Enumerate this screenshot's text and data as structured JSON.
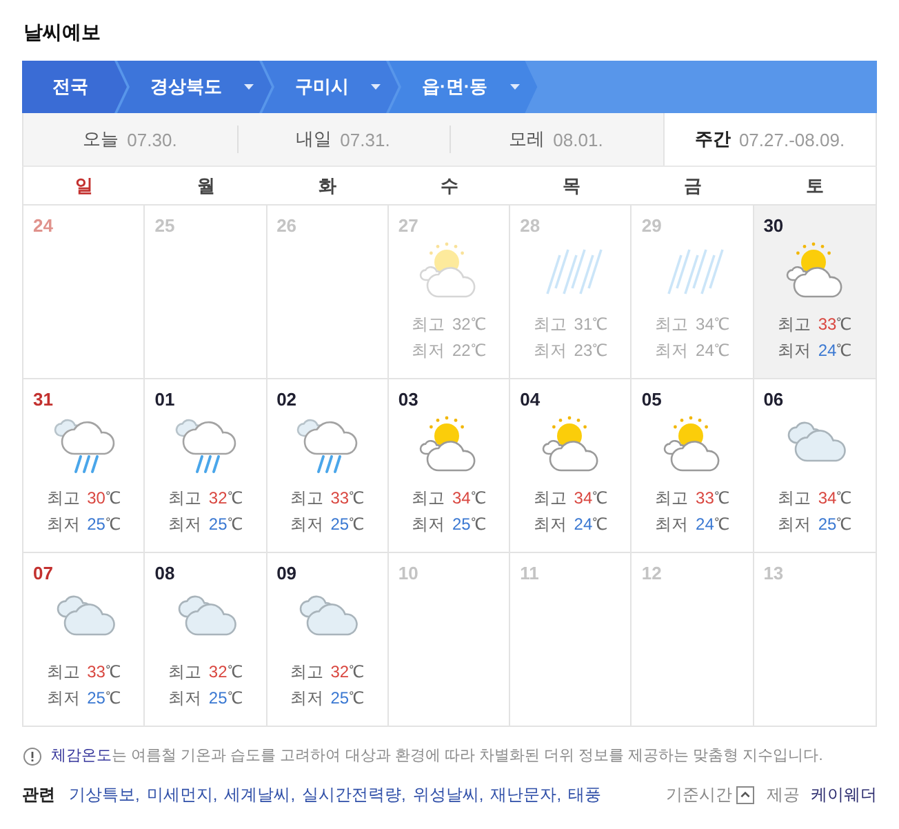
{
  "title": "날씨예보",
  "regions": [
    {
      "label": "전국",
      "dropdown": false
    },
    {
      "label": "경상북도",
      "dropdown": true
    },
    {
      "label": "구미시",
      "dropdown": true
    },
    {
      "label": "읍·면·동",
      "dropdown": true
    }
  ],
  "date_tabs": [
    {
      "label": "오늘",
      "date": "07.30.",
      "selected": false
    },
    {
      "label": "내일",
      "date": "07.31.",
      "selected": false
    },
    {
      "label": "모레",
      "date": "08.01.",
      "selected": false
    },
    {
      "label": "주간",
      "date": "07.27.-08.09.",
      "selected": true
    }
  ],
  "weekdays": [
    {
      "label": "일",
      "holiday": true
    },
    {
      "label": "월",
      "holiday": false
    },
    {
      "label": "화",
      "holiday": false
    },
    {
      "label": "수",
      "holiday": false
    },
    {
      "label": "목",
      "holiday": false
    },
    {
      "label": "금",
      "holiday": false
    },
    {
      "label": "토",
      "holiday": false
    }
  ],
  "weeks": [
    {
      "days": [
        {
          "kind": "empty",
          "date": "24",
          "dimmed": true,
          "today": false
        },
        {
          "kind": "empty",
          "date": "25",
          "dimmed": true,
          "today": false
        },
        {
          "kind": "empty",
          "date": "26",
          "dimmed": true,
          "today": false
        },
        {
          "kind": "suncloud",
          "date": "27",
          "dimmed": true,
          "today": false,
          "temps": [
            {
              "kind": "high",
              "label": "최고",
              "value": "32",
              "unit": "℃"
            },
            {
              "kind": "low",
              "label": "최저",
              "value": "22",
              "unit": "℃"
            }
          ]
        },
        {
          "kind": "rain",
          "date": "28",
          "dimmed": true,
          "today": false,
          "temps": [
            {
              "kind": "high",
              "label": "최고",
              "value": "31",
              "unit": "℃"
            },
            {
              "kind": "low",
              "label": "최저",
              "value": "23",
              "unit": "℃"
            }
          ]
        },
        {
          "kind": "rain",
          "date": "29",
          "dimmed": true,
          "today": false,
          "temps": [
            {
              "kind": "high",
              "label": "최고",
              "value": "34",
              "unit": "℃"
            },
            {
              "kind": "low",
              "label": "최저",
              "value": "24",
              "unit": "℃"
            }
          ]
        },
        {
          "kind": "suncloud",
          "date": "30",
          "dimmed": false,
          "today": true,
          "temps": [
            {
              "kind": "high",
              "label": "최고",
              "value": "33",
              "unit": "℃"
            },
            {
              "kind": "low",
              "label": "최저",
              "value": "24",
              "unit": "℃"
            }
          ]
        }
      ]
    },
    {
      "days": [
        {
          "kind": "showers",
          "date": "31",
          "dimmed": false,
          "today": false,
          "temps": [
            {
              "kind": "high",
              "label": "최고",
              "value": "30",
              "unit": "℃"
            },
            {
              "kind": "low",
              "label": "최저",
              "value": "25",
              "unit": "℃"
            }
          ]
        },
        {
          "kind": "showers",
          "date": "01",
          "dimmed": false,
          "today": false,
          "temps": [
            {
              "kind": "high",
              "label": "최고",
              "value": "32",
              "unit": "℃"
            },
            {
              "kind": "low",
              "label": "최저",
              "value": "25",
              "unit": "℃"
            }
          ]
        },
        {
          "kind": "showers",
          "date": "02",
          "dimmed": false,
          "today": false,
          "temps": [
            {
              "kind": "high",
              "label": "최고",
              "value": "33",
              "unit": "℃"
            },
            {
              "kind": "low",
              "label": "최저",
              "value": "25",
              "unit": "℃"
            }
          ]
        },
        {
          "kind": "suncloud",
          "date": "03",
          "dimmed": false,
          "today": false,
          "temps": [
            {
              "kind": "high",
              "label": "최고",
              "value": "34",
              "unit": "℃"
            },
            {
              "kind": "low",
              "label": "최저",
              "value": "25",
              "unit": "℃"
            }
          ]
        },
        {
          "kind": "suncloud",
          "date": "04",
          "dimmed": false,
          "today": false,
          "temps": [
            {
              "kind": "high",
              "label": "최고",
              "value": "34",
              "unit": "℃"
            },
            {
              "kind": "low",
              "label": "최저",
              "value": "24",
              "unit": "℃"
            }
          ]
        },
        {
          "kind": "suncloud",
          "date": "05",
          "dimmed": false,
          "today": false,
          "temps": [
            {
              "kind": "high",
              "label": "최고",
              "value": "33",
              "unit": "℃"
            },
            {
              "kind": "low",
              "label": "최저",
              "value": "24",
              "unit": "℃"
            }
          ]
        },
        {
          "kind": "cloudy",
          "date": "06",
          "dimmed": false,
          "today": false,
          "temps": [
            {
              "kind": "high",
              "label": "최고",
              "value": "34",
              "unit": "℃"
            },
            {
              "kind": "low",
              "label": "최저",
              "value": "25",
              "unit": "℃"
            }
          ]
        }
      ]
    },
    {
      "days": [
        {
          "kind": "cloudy",
          "date": "07",
          "dimmed": false,
          "today": false,
          "temps": [
            {
              "kind": "high",
              "label": "최고",
              "value": "33",
              "unit": "℃"
            },
            {
              "kind": "low",
              "label": "최저",
              "value": "25",
              "unit": "℃"
            }
          ]
        },
        {
          "kind": "cloudy",
          "date": "08",
          "dimmed": false,
          "today": false,
          "temps": [
            {
              "kind": "high",
              "label": "최고",
              "value": "32",
              "unit": "℃"
            },
            {
              "kind": "low",
              "label": "최저",
              "value": "25",
              "unit": "℃"
            }
          ]
        },
        {
          "kind": "cloudy",
          "date": "09",
          "dimmed": false,
          "today": false,
          "temps": [
            {
              "kind": "high",
              "label": "최고",
              "value": "32",
              "unit": "℃"
            },
            {
              "kind": "low",
              "label": "최저",
              "value": "25",
              "unit": "℃"
            }
          ]
        },
        {
          "kind": "empty",
          "date": "10",
          "dimmed": true,
          "today": false
        },
        {
          "kind": "empty",
          "date": "11",
          "dimmed": true,
          "today": false
        },
        {
          "kind": "empty",
          "date": "12",
          "dimmed": true,
          "today": false
        },
        {
          "kind": "empty",
          "date": "13",
          "dimmed": true,
          "today": false
        }
      ]
    }
  ],
  "note": {
    "link": "체감온도",
    "text": "는 여름철 기온과 습도를 고려하여 대상과 환경에 따라 차별화된 더위 정보를 제공하는 맞춤형 지수입니다."
  },
  "related": {
    "label": "관련",
    "links": [
      "기상특보,",
      "미세먼지,",
      "세계날씨,",
      "실시간전력량,",
      "위성날씨,",
      "재난문자,",
      "태풍"
    ]
  },
  "base_time": {
    "label": "기준시간"
  },
  "provider": {
    "label": "제공",
    "name": "케이웨더"
  }
}
